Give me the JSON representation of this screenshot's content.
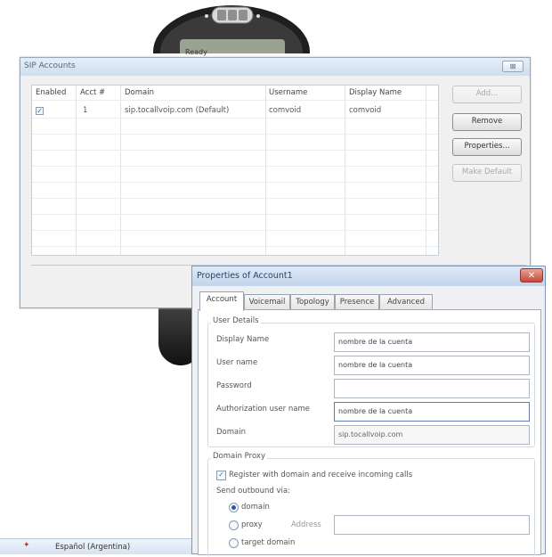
{
  "phone": {
    "screen_text": "Ready"
  },
  "sip_window": {
    "title": "SIP Accounts",
    "close_glyph": "⊠",
    "columns": [
      "Enabled",
      "Acct #",
      "Domain",
      "Username",
      "Display Name"
    ],
    "rows": [
      {
        "enabled_mark": "✓",
        "acct": "1",
        "domain": "sip.tocallvoip.com (Default)",
        "username": "comvoid",
        "display_name": "comvoid"
      }
    ],
    "buttons": {
      "add": "Add...",
      "remove": "Remove",
      "properties": "Properties...",
      "make_default": "Make Default"
    }
  },
  "properties_window": {
    "title": "Properties of Account1",
    "close_glyph": "✕",
    "tabs": [
      "Account",
      "Voicemail",
      "Topology",
      "Presence",
      "Advanced"
    ],
    "user_details": {
      "title": "User Details",
      "display_name_label": "Display Name",
      "display_name_value": "nombre de la cuenta",
      "user_name_label": "User name",
      "user_name_value": "nombre de la cuenta",
      "password_label": "Password",
      "password_value": "",
      "auth_user_label": "Authorization user name",
      "auth_user_value": "nombre de la cuenta",
      "domain_label": "Domain",
      "domain_value": "sip.tocallvoip.com"
    },
    "domain_proxy": {
      "title": "Domain Proxy",
      "register_mark": "✓",
      "register_label": "Register with domain and receive incoming calls",
      "send_outbound_label": "Send outbound via:",
      "options": {
        "domain": "domain",
        "proxy": "proxy",
        "target": "target domain"
      },
      "address_label": "Address",
      "selected": "domain"
    }
  },
  "taskbar": {
    "language_label": "Español (Argentina)"
  },
  "colors": {
    "title_text": "#23446e",
    "close_red": "#c9473a",
    "check_blue": "#3d64a8"
  }
}
